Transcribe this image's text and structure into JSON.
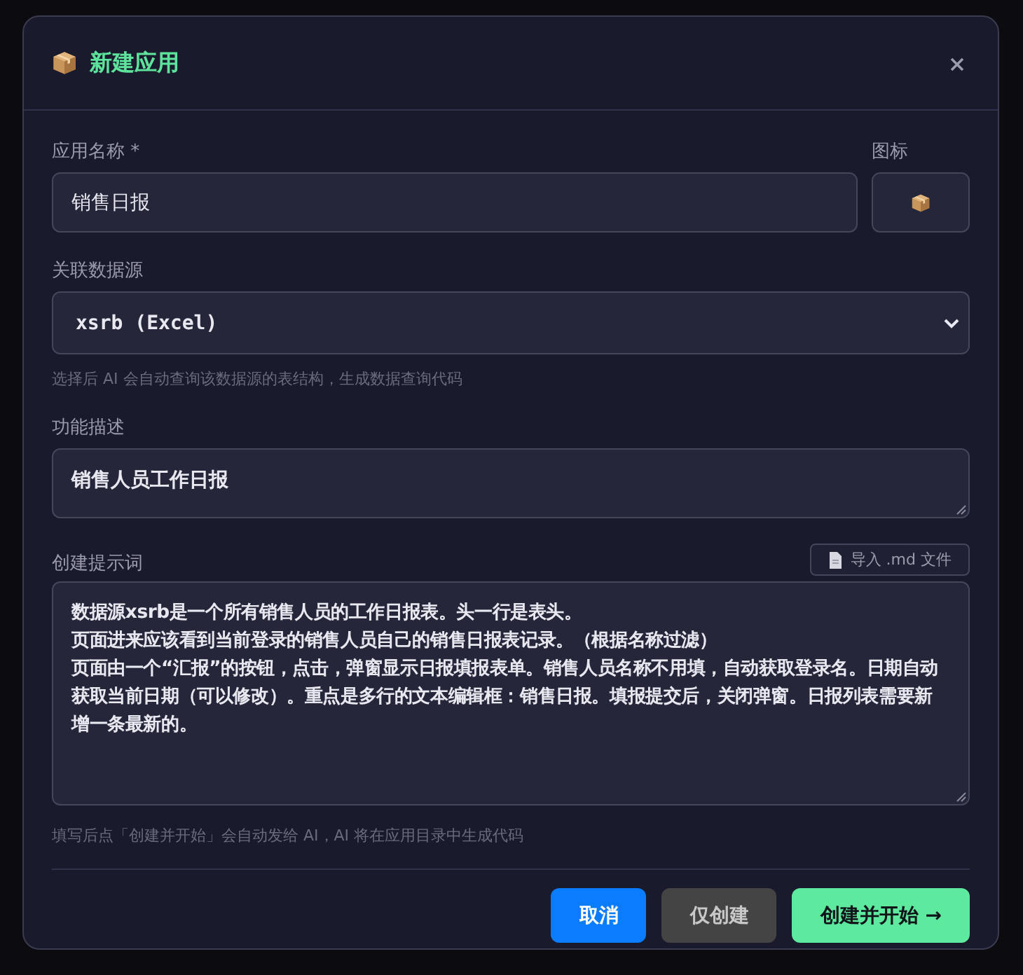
{
  "dialog": {
    "title": "新建应用"
  },
  "name_field": {
    "label": "应用名称 *",
    "value": "销售日报"
  },
  "icon_field": {
    "label": "图标"
  },
  "datasource": {
    "label": "关联数据源",
    "value": "xsrb (Excel)",
    "hint": "选择后 AI 会自动查询该数据源的表结构，生成数据查询代码"
  },
  "description": {
    "label": "功能描述",
    "value": "销售人员工作日报"
  },
  "prompt": {
    "label": "创建提示词",
    "import_button": ".md 文件",
    "import_prefix": "导入",
    "lines": [
      "数据源xsrb是一个所有销售人员的工作日报表。头一行是表头。",
      "页面进来应该看到当前登录的销售人员自己的销售日报表记录。（根据名称过滤）",
      "页面由一个“汇报”的按钮，点击，弹窗显示日报填报表单。销售人员名称不用填，自动获取登录名。日期自动获取当前日期（可以修改）。重点是多行的文本编辑框：销售日报。填报提交后，关闭弹窗。日报列表需要新增一条最新的。"
    ],
    "hint": "填写后点「创建并开始」会自动发给 AI，AI 将在应用目录中生成代码"
  },
  "buttons": [
    {
      "label": "取消",
      "kind": "primary"
    },
    {
      "label": "仅创建",
      "kind": "secondary"
    },
    {
      "label": "创建并开始 →",
      "kind": "accent"
    }
  ]
}
